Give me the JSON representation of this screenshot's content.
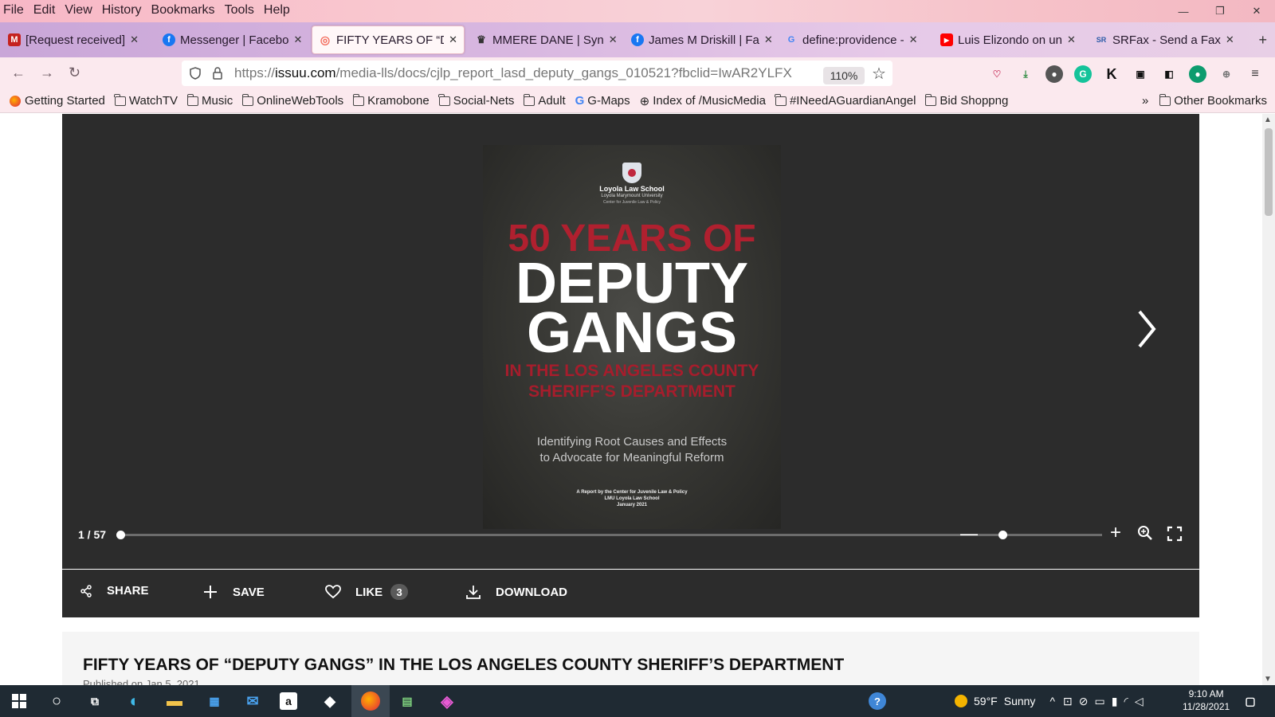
{
  "menu": [
    "File",
    "Edit",
    "View",
    "History",
    "Bookmarks",
    "Tools",
    "Help"
  ],
  "tabs": [
    {
      "title": "[Request received]",
      "favicon": "gmail-icon",
      "color": "#c5221f",
      "glyph": "M"
    },
    {
      "title": "Messenger | Facebo",
      "favicon": "facebook-icon",
      "color": "#1877f2",
      "glyph": "f"
    },
    {
      "title": "FIFTY YEARS OF “DE",
      "favicon": "issuu-icon",
      "color": "#f36d5d",
      "glyph": "◎",
      "active": true
    },
    {
      "title": "MMERE DANE | Syn",
      "favicon": "cat-icon",
      "color": "#333333",
      "glyph": "♛"
    },
    {
      "title": "James M Driskill | Fa",
      "favicon": "facebook-icon",
      "color": "#1877f2",
      "glyph": "f"
    },
    {
      "title": "define:providence -",
      "favicon": "google-icon",
      "color": "#4285f4",
      "glyph": "G"
    },
    {
      "title": "Luis Elizondo on un",
      "favicon": "youtube-icon",
      "color": "#ff0000",
      "glyph": "▶"
    },
    {
      "title": "SRFax - Send a Fax",
      "favicon": "srfax-icon",
      "color": "#2b5aa8",
      "glyph": "SR"
    }
  ],
  "nav": {
    "url_domain": "issuu.com",
    "url_prefix": "https://",
    "url_suffix": "/media-lls/docs/cjlp_report_lasd_deputy_gangs_010521?fbclid=IwAR2YLFX",
    "zoom": "110%"
  },
  "bookmarks": [
    {
      "label": "Getting Started",
      "icon": "firefox-icon"
    },
    {
      "label": "WatchTV",
      "icon": "folder-icon"
    },
    {
      "label": "Music",
      "icon": "folder-icon"
    },
    {
      "label": "OnlineWebTools",
      "icon": "folder-icon"
    },
    {
      "label": "Kramobone",
      "icon": "folder-icon"
    },
    {
      "label": "Social-Nets",
      "icon": "folder-icon"
    },
    {
      "label": "Adult",
      "icon": "folder-icon"
    },
    {
      "label": "G-Maps",
      "icon": "google-icon"
    },
    {
      "label": "Index of /MusicMedia",
      "icon": "globe-icon"
    },
    {
      "label": "#INeedAGuardianAngel",
      "icon": "folder-icon"
    },
    {
      "label": "Bid Shoppng",
      "icon": "folder-icon"
    }
  ],
  "bookmarks_overflow": "»",
  "other_bookmarks": "Other Bookmarks",
  "cover": {
    "school": "Loyola Law School",
    "university": "Loyola Marymount University",
    "center": "Center for Juvenile Law & Policy",
    "years": "50 YEARS OF",
    "deputy": "DEPUTY",
    "gangs": "GANGS",
    "sub1": "IN THE LOS ANGELES COUNTY",
    "sub2": "SHERIFF’S DEPARTMENT",
    "tag1": "Identifying Root Causes and Effects",
    "tag2": "to Advocate for Meaningful Reform",
    "rep1": "A Report by the Center for Juvenile Law & Policy",
    "rep2": "LMU Loyola Law School",
    "rep3": "January 2021"
  },
  "viewer": {
    "page_indicator": "1 / 57",
    "page_progress": 0.0,
    "zoom_level": 0.13
  },
  "actions": {
    "share": "SHARE",
    "save": "SAVE",
    "like": "LIKE",
    "like_count": "3",
    "download": "DOWNLOAD"
  },
  "doc": {
    "title": "FIFTY YEARS OF “DEPUTY GANGS” IN THE LOS ANGELES COUNTY SHERIFF’S DEPARTMENT",
    "published": "Published on Jan 5, 2021"
  },
  "taskbar": {
    "weather_temp": "59°F",
    "weather_desc": "Sunny",
    "time": "9:10 AM",
    "date": "11/28/2021"
  },
  "colors": {
    "accent_red": "#b0202f",
    "viewer_bg": "#2c2c2c",
    "taskbar_bg": "#1f2a33"
  }
}
